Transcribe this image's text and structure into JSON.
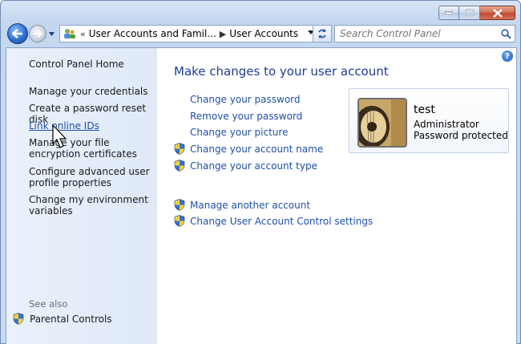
{
  "window": {
    "caption_buttons": [
      "minimize",
      "maximize",
      "close"
    ]
  },
  "addressbar": {
    "chevron": "«",
    "crumbs": [
      "User Accounts and Famil...",
      "User Accounts"
    ],
    "separator": "▶"
  },
  "search": {
    "placeholder": "Search Control Panel"
  },
  "sidebar": {
    "home": "Control Panel Home",
    "items": [
      {
        "label": "Manage your credentials"
      },
      {
        "label": "Create a password reset disk"
      },
      {
        "label": "Link online IDs"
      },
      {
        "label": "Manage your file encryption certificates"
      },
      {
        "label": "Configure advanced user profile properties"
      },
      {
        "label": "Change my environment variables"
      }
    ],
    "see_also": "See also",
    "parental_controls": "Parental Controls"
  },
  "main": {
    "title": "Make changes to your user account",
    "tasks": [
      {
        "label": "Change your password",
        "shield": false
      },
      {
        "label": "Remove your password",
        "shield": false
      },
      {
        "label": "Change your picture",
        "shield": false
      },
      {
        "label": "Change your account name",
        "shield": true
      },
      {
        "label": "Change your account type",
        "shield": true
      }
    ],
    "other_tasks": [
      {
        "label": "Manage another account",
        "shield": true
      },
      {
        "label": "Change User Account Control settings",
        "shield": true
      }
    ]
  },
  "user": {
    "name": "test",
    "role": "Administrator",
    "status": "Password protected"
  },
  "colors": {
    "link": "#1f4fa8",
    "title": "#1e3c96",
    "sidebar_bg": "#e4edf9"
  }
}
